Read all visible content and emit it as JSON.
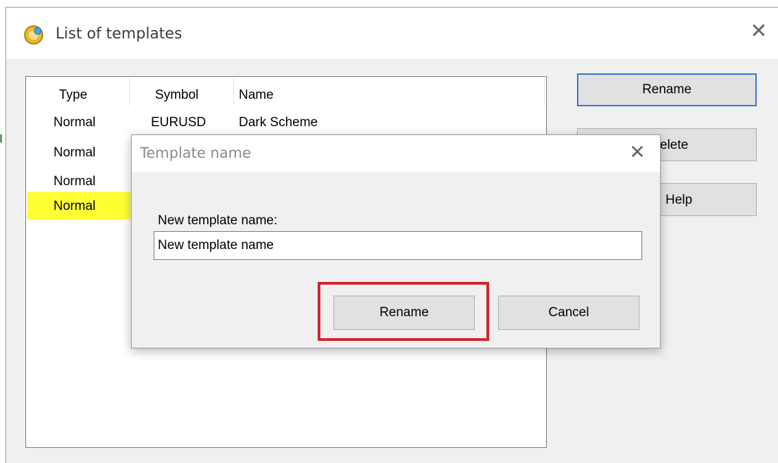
{
  "window": {
    "title": "List of templates",
    "close_glyph": "✕",
    "icon": "templates-app-icon"
  },
  "list": {
    "headers": [
      "Type",
      "Symbol",
      "Name"
    ],
    "rows": [
      {
        "type": "Normal",
        "symbol": "EURUSD",
        "name": "Dark Scheme"
      },
      {
        "type": "Normal",
        "symbol": "",
        "name": ""
      },
      {
        "type": "Normal",
        "symbol": "",
        "name": ""
      },
      {
        "type": "Normal",
        "symbol": "",
        "name": "",
        "highlighted": true
      }
    ],
    "highlight_color": "#ffff33"
  },
  "side_buttons": {
    "rename": "Rename",
    "delete_partial": "elete",
    "help_partial": "Help"
  },
  "dialog": {
    "title": "Template name",
    "close_glyph": "✕",
    "field_label": "New template name:",
    "input_value": "New template name",
    "rename_label": "Rename",
    "cancel_label": "Cancel",
    "highlight_color": "#d2232f"
  },
  "colors": {
    "focus_border": "#3a73c9",
    "button_face": "#e1e1e1",
    "dialog_bg": "#f0f0f0"
  }
}
